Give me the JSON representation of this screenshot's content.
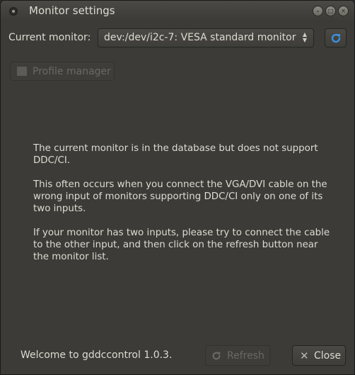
{
  "window": {
    "title": "Monitor settings"
  },
  "monitor": {
    "label": "Current monitor:",
    "selected": "dev:/dev/i2c-7: VESA standard monitor"
  },
  "profile_manager": {
    "label": "Profile manager"
  },
  "message": {
    "p1": "The current monitor is in the database but does not support DDC/CI.",
    "p2": "This often occurs when you connect the VGA/DVI cable on the wrong input of monitors supporting DDC/CI only on one of its two inputs.",
    "p3": "If your monitor has two inputs, please try to connect the cable to the other input, and then click on the refresh button near the monitor list."
  },
  "footer": {
    "status": "Welcome to gddccontrol 1.0.3.",
    "refresh_label": "Refresh",
    "close_label": "Close"
  },
  "icons": {
    "refresh": "refresh-icon",
    "close": "close-icon",
    "profile": "folder-icon"
  },
  "colors": {
    "accent_blue": "#3d8fd9",
    "window_bg": "#3c3b37"
  }
}
